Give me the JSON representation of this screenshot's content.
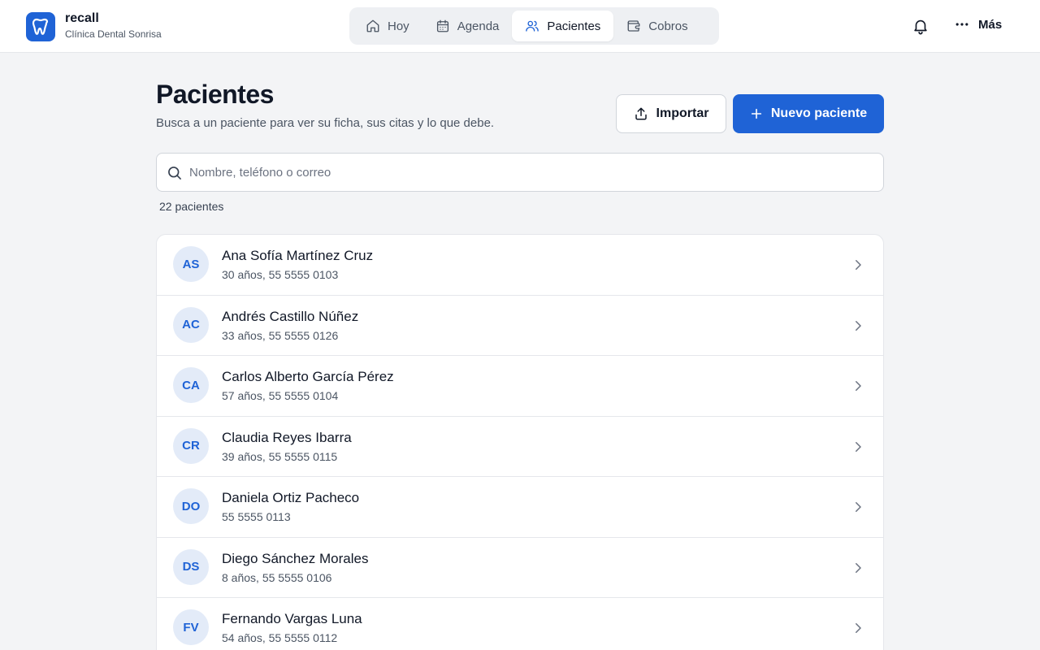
{
  "brand": {
    "name": "recall",
    "clinic": "Clínica Dental Sonrisa"
  },
  "nav": [
    {
      "label": "Hoy",
      "icon": "home-icon",
      "active": false
    },
    {
      "label": "Agenda",
      "icon": "calendar-icon",
      "active": false
    },
    {
      "label": "Pacientes",
      "icon": "users-icon",
      "active": true
    },
    {
      "label": "Cobros",
      "icon": "wallet-icon",
      "active": false
    }
  ],
  "header_actions": {
    "more_label": "Más"
  },
  "page": {
    "title": "Pacientes",
    "subtitle": "Busca a un paciente para ver su ficha, sus citas y lo que debe.",
    "import_label": "Importar",
    "new_label": "Nuevo paciente",
    "count": "22 pacientes"
  },
  "search": {
    "placeholder": "Nombre, teléfono o correo",
    "value": ""
  },
  "patients": [
    {
      "initials": "AS",
      "name": "Ana Sofía Martínez Cruz",
      "meta": "30 años, 55 5555 0103"
    },
    {
      "initials": "AC",
      "name": "Andrés Castillo Núñez",
      "meta": "33 años, 55 5555 0126"
    },
    {
      "initials": "CA",
      "name": "Carlos Alberto García Pérez",
      "meta": "57 años, 55 5555 0104"
    },
    {
      "initials": "CR",
      "name": "Claudia Reyes Ibarra",
      "meta": "39 años, 55 5555 0115"
    },
    {
      "initials": "DO",
      "name": "Daniela Ortiz Pacheco",
      "meta": "55 5555 0113"
    },
    {
      "initials": "DS",
      "name": "Diego Sánchez Morales",
      "meta": "8 años, 55 5555 0106"
    },
    {
      "initials": "FV",
      "name": "Fernando Vargas Luna",
      "meta": "54 años, 55 5555 0112"
    }
  ],
  "colors": {
    "accent": "#1f63d6",
    "avatar_bg": "#e3ebf8",
    "background": "#f3f4f6"
  }
}
